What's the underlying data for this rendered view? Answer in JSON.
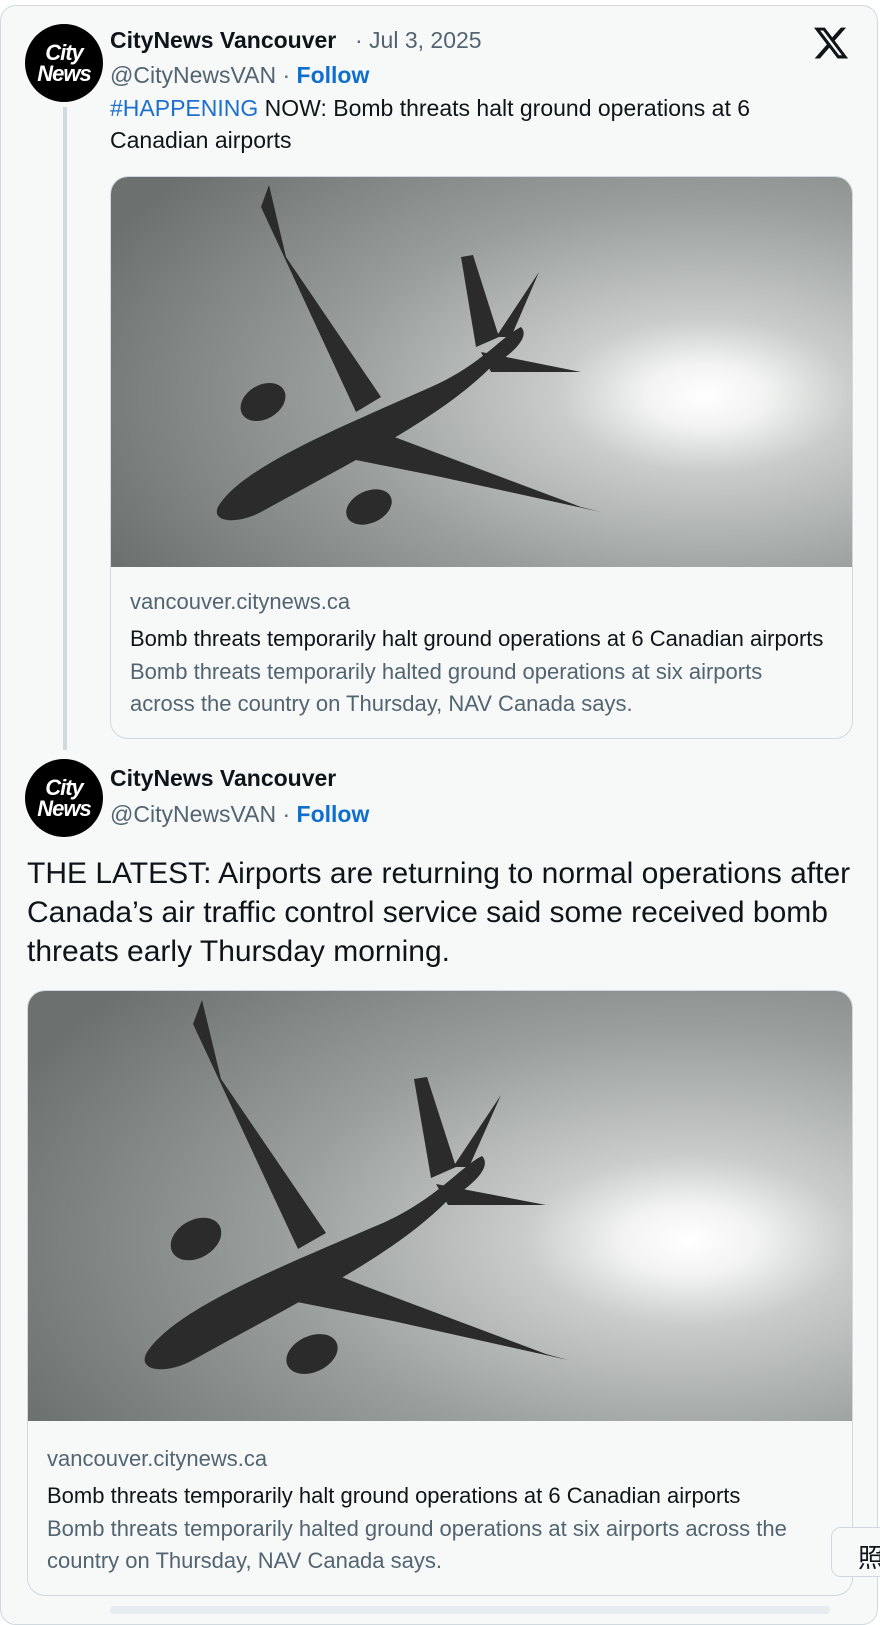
{
  "tweet1": {
    "avatar": {
      "line1": "City",
      "line2": "News"
    },
    "name": "CityNews Vancouver",
    "date": "· Jul 3, 2025",
    "handle": "@CityNewsVAN",
    "separator": "·",
    "follow": "Follow",
    "hashtag": "#HAPPENING",
    "text": "NOW: Bomb threats halt ground operations at 6 Canadian airports",
    "card": {
      "domain": "vancouver.citynews.ca",
      "title": "Bomb threats temporarily halt ground operations at 6 Canadian airports",
      "description": "Bomb threats temporarily halted ground operations at six airports across the country on Thursday, NAV Canada says."
    }
  },
  "tweet2": {
    "avatar": {
      "line1": "City",
      "line2": "News"
    },
    "name": "CityNews Vancouver",
    "handle": "@CityNewsVAN",
    "separator": "·",
    "follow": "Follow",
    "text": "THE LATEST: Airports are returning to normal operations after Canada’s air traffic control service said some received bomb threats early Thursday morning.",
    "card": {
      "domain": "vancouver.citynews.ca",
      "title": "Bomb threats temporarily halt ground operations at 6 Canadian airports",
      "description": "Bomb threats temporarily halted ground operations at six airports across the country on Thursday, NAV Canada says."
    }
  },
  "side_button": {
    "label": "照"
  },
  "icons": {
    "brand": "x-logo-icon",
    "media": "airplane-silhouette-image"
  },
  "colors": {
    "link": "#1d6fcf",
    "text": "#0f1419",
    "muted": "#536471",
    "border": "#cfd9de"
  }
}
